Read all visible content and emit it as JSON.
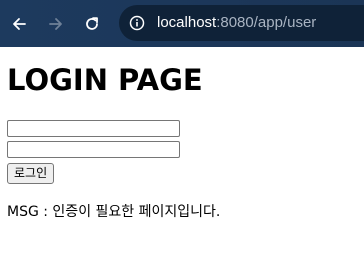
{
  "browser": {
    "url_host": "localhost",
    "url_rest": ":8080/app/user",
    "icons": {
      "back": "arrow-left-icon",
      "forward": "arrow-right-icon",
      "reload": "reload-icon",
      "site_info": "info-icon"
    },
    "colors": {
      "toolbar": "#1d3a5e",
      "address_bar": "#0f2238",
      "forward_disabled": "#6f8198"
    }
  },
  "page": {
    "title": "LOGIN PAGE",
    "username_value": "",
    "password_value": "",
    "login_button_label": "로그인",
    "message": "MSG : 인증이 필요한 페이지입니다."
  }
}
